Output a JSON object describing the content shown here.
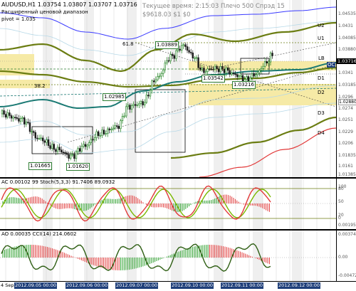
{
  "chart": {
    "symbol_info": "AUDUSD,H1 1.03754 1.03807 1.03707 1.03716",
    "indicator_title": "Расширенный ценовой диапазон",
    "indicator_sub": "pivot = 1.035",
    "timer_line": "Текущее время: 2:15:03 Плечо 500 Спрэд 15",
    "balance_line": "$9618.03  $1  $0"
  },
  "level_labels": {
    "u2": "U2",
    "u1": "U1",
    "lb": "LB",
    "oc": "OC",
    "d1": "D1",
    "d2": "D2",
    "d3": "D3",
    "d4": "D4"
  },
  "annotations": {
    "fib_618": "61.8",
    "fib_382": "38.2",
    "high_1": "1.03889",
    "low_1": "1.03542",
    "low_2": "1.03216",
    "mid_1": "1.02985",
    "low_3": "1.01665",
    "low_4": "1.01620"
  },
  "price_axis": {
    "ticks": [
      "1.04535",
      "1.0431",
      "1.04085",
      "1.03880",
      "1.0363",
      "1.0341",
      "1.03185",
      "1.0296",
      "1.0274",
      "1.0251",
      "1.0229",
      "1.0206",
      "1.01835",
      "1.0161",
      "1.01385"
    ],
    "current": "1.03716",
    "lower": "1.02880"
  },
  "ac_panel": {
    "label": "AC 0.00102 99  Stoch(5,3,3) 91.7406 89.0932",
    "ticks": [
      "100",
      "80",
      "50",
      "20",
      "0",
      "0.00195"
    ]
  },
  "ao_panel": {
    "label": "AO 0.00035  CCI(14) 214.0602",
    "ticks": [
      "0.00374",
      "0.00",
      "-0.00472"
    ]
  },
  "time_axis": {
    "labels": [
      "4 Sep 2012",
      "2012.09.05 00:00",
      "2012.09.06 00:00",
      "2012.09.07 00:00",
      "2012.09.10 00:00",
      "2012.09.11 00:00",
      "2012.09.12 00:00"
    ]
  },
  "colors": {
    "bull": "#1b7f1b",
    "bear": "#1a1a1a",
    "ma_olive": "#6b7d12",
    "ma_teal": "#1b7a74",
    "ma_blue": "#3a3aff",
    "zone": "#f6eaa6",
    "vgrid": "#d9d9d9",
    "ac_green": "#2ea02e",
    "ac_red": "#e23a3a",
    "stoch_main": "#e23a3a",
    "stoch_signal": "#7ab800"
  }
}
